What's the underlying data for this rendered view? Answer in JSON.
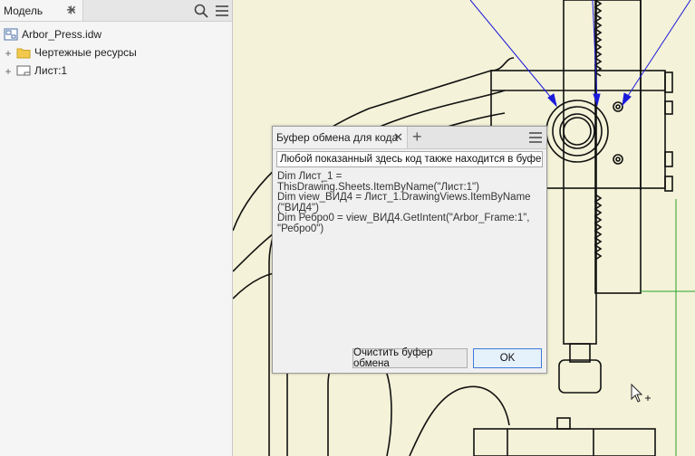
{
  "browser": {
    "tab_label": "Модель",
    "tree": [
      {
        "label": "Arbor_Press.idw",
        "icon": "drawing-file-icon",
        "expander": ""
      },
      {
        "label": "Чертежные ресурсы",
        "icon": "folder-icon",
        "expander": "+"
      },
      {
        "label": "Лист:1",
        "icon": "sheet-icon",
        "expander": "+"
      }
    ]
  },
  "dialog": {
    "tab_label": "Буфер обмена для кода",
    "info_text": "Любой показанный здесь код также находится в буфере обмена.",
    "code_lines": [
      "Dim Лист_1 = ThisDrawing.Sheets.ItemByName(\"Лист:1\")",
      "Dim view_ВИД4 = Лист_1.DrawingViews.ItemByName (\"ВИД4\")",
      "Dim Ребро0 = view_ВИД4.GetIntent(\"Arbor_Frame:1\", \"Ребро0\")"
    ],
    "clear_button": "Очистить буфер обмена",
    "ok_button": "OK"
  },
  "colors": {
    "canvas": "#f4f2d8",
    "leader_lines": "#1a1adb",
    "ok_border": "#3d7bd9"
  }
}
